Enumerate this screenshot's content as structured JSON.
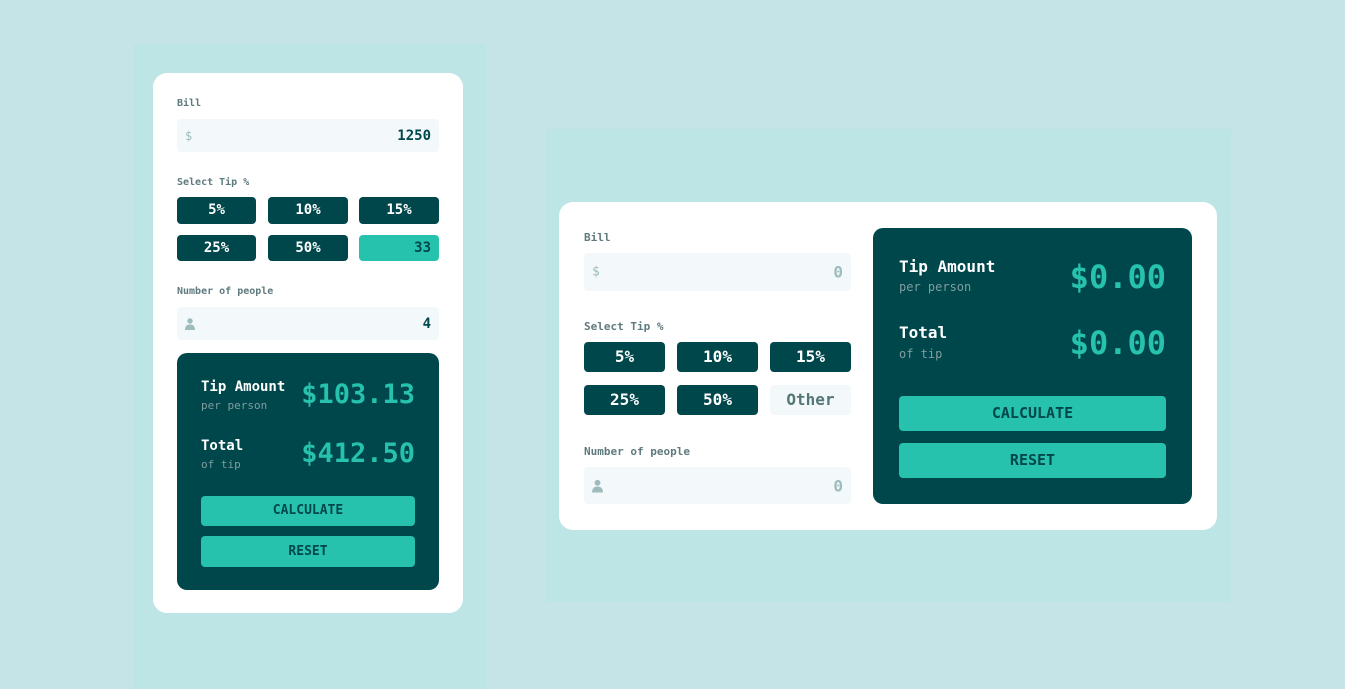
{
  "mobile": {
    "bill_label": "Bill",
    "bill_prefix": "$",
    "bill_value": "1250",
    "tip_label": "Select Tip %",
    "tip_options": [
      "5%",
      "10%",
      "15%",
      "25%",
      "50%"
    ],
    "tip_custom_value": "33",
    "people_label": "Number of people",
    "people_value": "4",
    "tip_amount_title": "Tip Amount",
    "tip_amount_sub": "per person",
    "tip_amount_value": "$103.13",
    "total_title": "Total",
    "total_sub": "of tip",
    "total_value": "$412.50",
    "calculate_label": "CALCULATE",
    "reset_label": "RESET"
  },
  "desktop": {
    "bill_label": "Bill",
    "bill_prefix": "$",
    "bill_value": "0",
    "tip_label": "Select Tip %",
    "tip_options": [
      "5%",
      "10%",
      "15%",
      "25%",
      "50%"
    ],
    "tip_other_label": "Other",
    "people_label": "Number of people",
    "people_value": "0",
    "tip_amount_title": "Tip Amount",
    "tip_amount_sub": "per person",
    "tip_amount_value": "$0.00",
    "total_title": "Total",
    "total_sub": "of tip",
    "total_value": "$0.00",
    "calculate_label": "CALCULATE",
    "reset_label": "RESET"
  },
  "colors": {
    "background": "#c5e4e7",
    "card": "#ffffff",
    "dark_teal": "#00474b",
    "accent": "#26c2ad",
    "input_bg": "#f3f9fa",
    "label_grey": "#5e7a7d"
  },
  "icons": [
    "person-icon"
  ]
}
